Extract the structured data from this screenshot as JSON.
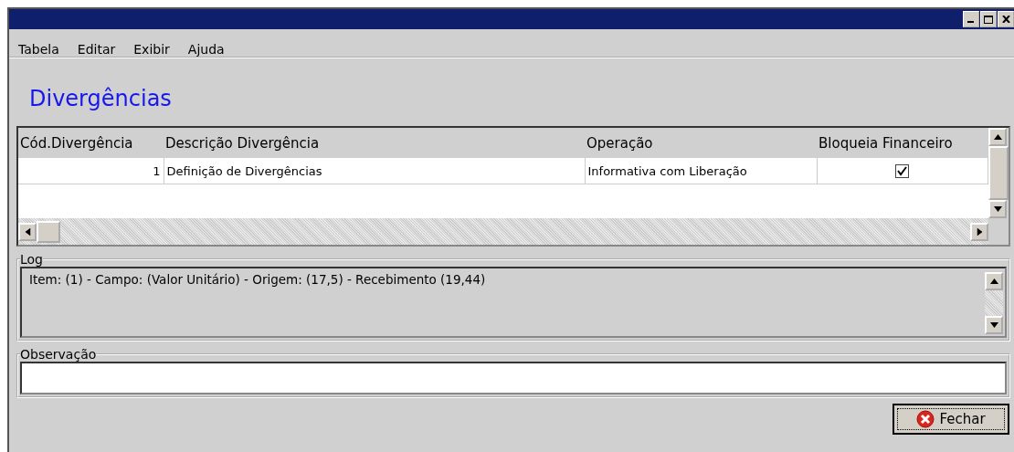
{
  "menu": [
    {
      "label": "Tabela"
    },
    {
      "label": "Editar"
    },
    {
      "label": "Exibir"
    },
    {
      "label": "Ajuda"
    }
  ],
  "heading": "Divergências",
  "table": {
    "columns": [
      "Cód.Divergência",
      "Descrição Divergência",
      "Operação",
      "Bloqueia Financeiro"
    ],
    "rows": [
      {
        "code": "1",
        "description": "Definição de Divergências",
        "operation": "Informativa com Liberação",
        "blocks_financial": true
      }
    ]
  },
  "log": {
    "label": "Log",
    "lines": [
      "Item: (1) - Campo: (Valor Unitário) - Origem: (17,5) - Recebimento (19,44)"
    ]
  },
  "observation": {
    "label": "Observação"
  },
  "buttons": [
    {
      "label": "Fechar",
      "kind": "close"
    }
  ]
}
